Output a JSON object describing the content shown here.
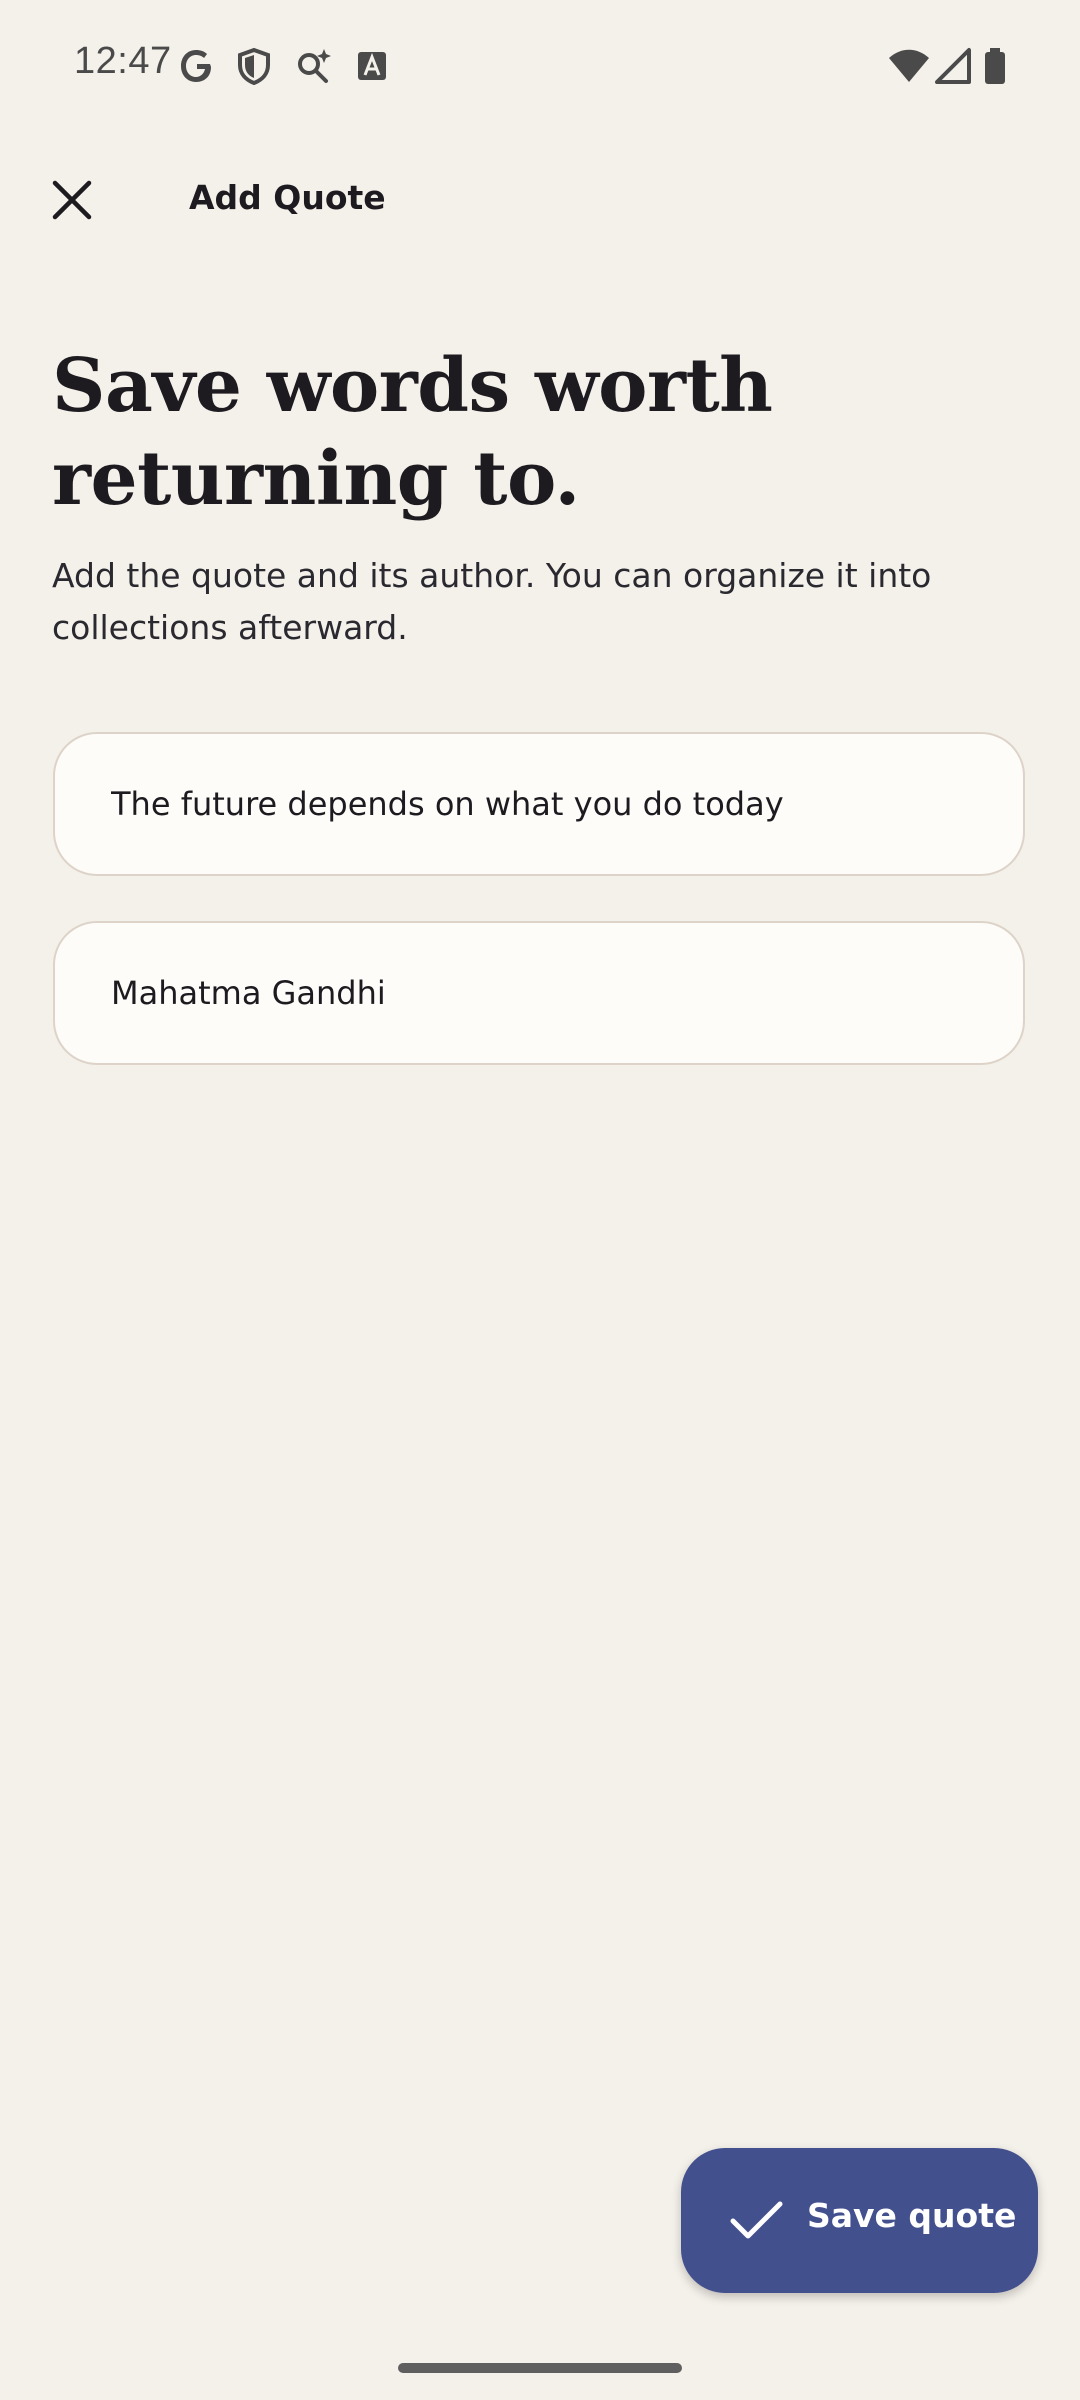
{
  "status_bar": {
    "time": "12:47",
    "icons": [
      "google-icon",
      "shield-icon",
      "sparkle-search-icon",
      "text-a-icon",
      "wifi-icon",
      "signal-icon",
      "battery-icon"
    ]
  },
  "app_bar": {
    "close_icon": "close-icon",
    "title": "Add Quote"
  },
  "content": {
    "headline": "Save words worth returning to.",
    "subtext": "Add the quote and its author. You can organize it into collections afterward."
  },
  "form": {
    "quote_value": "The future depends on what you do today",
    "author_value": "Mahatma Gandhi"
  },
  "actions": {
    "save_label": "Save quote",
    "save_icon": "check-icon"
  },
  "colors": {
    "background": "#f4f0ea",
    "field_background": "#fdfcf8",
    "field_border": "#ddd3c8",
    "primary_button": "#43508e"
  }
}
